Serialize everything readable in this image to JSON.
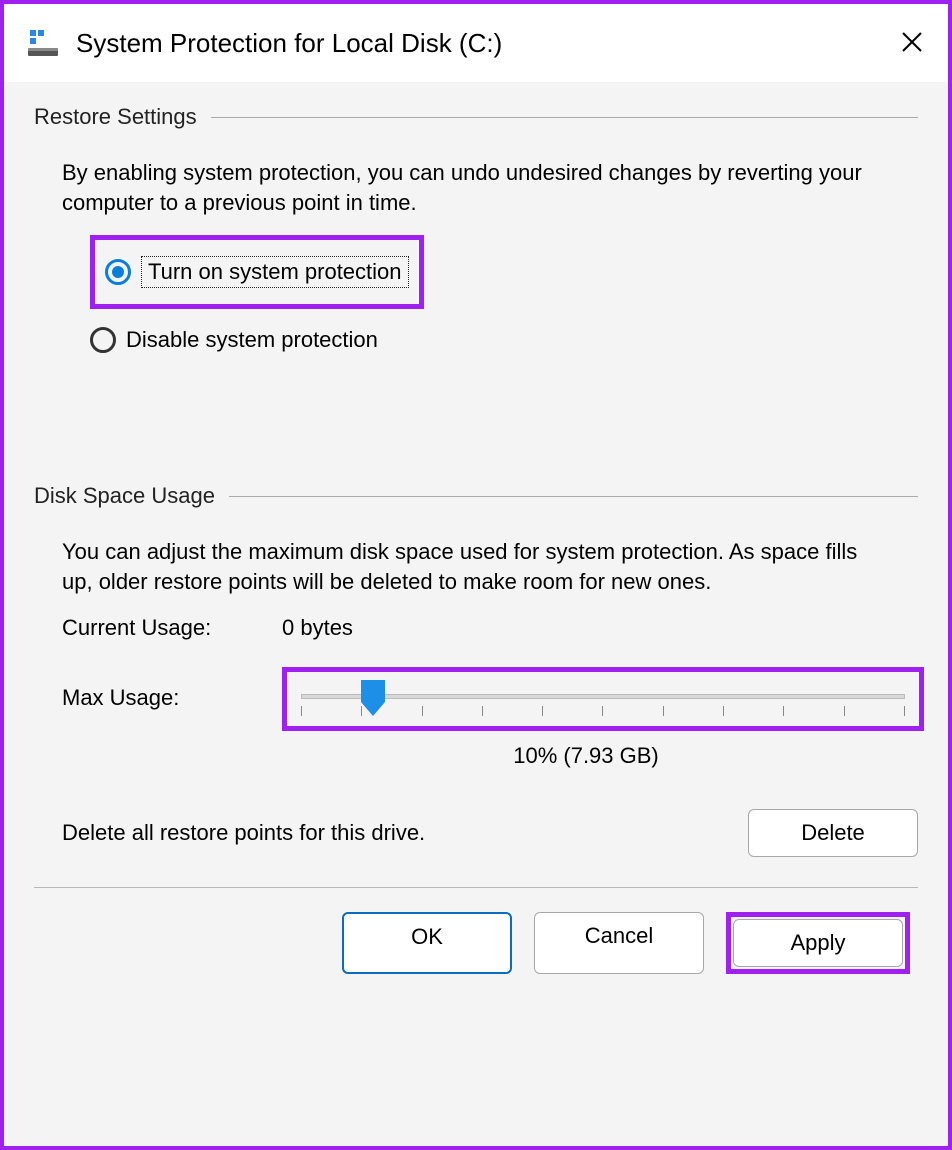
{
  "window": {
    "title": "System Protection for Local Disk (C:)"
  },
  "restore": {
    "group_label": "Restore Settings",
    "description": "By enabling system protection, you can undo undesired changes by reverting your computer to a previous point in time.",
    "option_on": "Turn on system protection",
    "option_off": "Disable system protection"
  },
  "usage": {
    "group_label": "Disk Space Usage",
    "description": "You can adjust the maximum disk space used for system protection. As space fills up, older restore points will be deleted to make room for new ones.",
    "current_label": "Current Usage:",
    "current_value": "0 bytes",
    "max_label": "Max Usage:",
    "slider_percent": 12,
    "slider_value_label": "10% (7.93 GB)",
    "delete_text": "Delete all restore points for this drive.",
    "delete_btn": "Delete"
  },
  "buttons": {
    "ok": "OK",
    "cancel": "Cancel",
    "apply": "Apply"
  }
}
